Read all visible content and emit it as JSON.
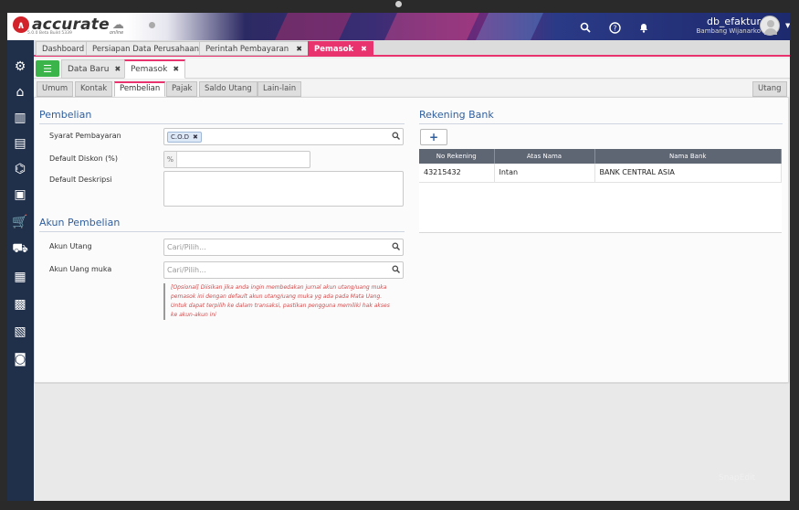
{
  "app": {
    "logo_text": "accurate",
    "logo_sub": "online",
    "version": "5.0.0 Beta Build 5339",
    "user_name": "db_efaktur",
    "user_sub": "Bambang Wijanarko"
  },
  "tabs_main": [
    {
      "label": "Dashboard"
    },
    {
      "label": "Persiapan Data Perusahaan"
    },
    {
      "label": "Perintah Pembayaran",
      "close": "✖"
    },
    {
      "label": "Pemasok",
      "close": "✖"
    }
  ],
  "tabs_sub": [
    {
      "label": "Data Baru",
      "close": "✖"
    },
    {
      "label": "Pemasok",
      "close": "✖"
    }
  ],
  "tabs_form": [
    "Umum",
    "Kontak",
    "Pembelian",
    "Pajak",
    "Saldo Utang",
    "Lain-lain"
  ],
  "tab_right": "Utang",
  "pembelian": {
    "title": "Pembelian",
    "syarat_label": "Syarat Pembayaran",
    "syarat_chip": "C.O.D",
    "diskon_label": "Default Diskon (%)",
    "diskon_prefix": "%",
    "deskripsi_label": "Default Deskripsi"
  },
  "akun": {
    "title": "Akun Pembelian",
    "utang_label": "Akun Utang",
    "utang_placeholder": "Cari/Pilih...",
    "uangmuka_label": "Akun Uang muka",
    "uangmuka_placeholder": "Cari/Pilih...",
    "note": "[Opsional] Diisikan jika anda ingin membedakan jurnal akun utang/uang muka pemasok ini dengan default akun utang/uang muka yg ada pada Mata Uang. Untuk dapat terpilih ke dalam transaksi, pastikan pengguna memiliki hak akses ke akun-akun ini"
  },
  "rekening": {
    "title": "Rekening Bank",
    "add": "+",
    "columns": [
      "No Rekening",
      "Atas Nama",
      "Nama Bank"
    ],
    "rows": [
      [
        "43215432",
        "Intan",
        "BANK CENTRAL ASIA"
      ]
    ]
  },
  "watermark": "SnapEdit",
  "colors": {
    "accent": "#e8336f",
    "sidebar": "#20304b",
    "section_title": "#2f5f9e",
    "menu_green": "#3bb54a"
  }
}
